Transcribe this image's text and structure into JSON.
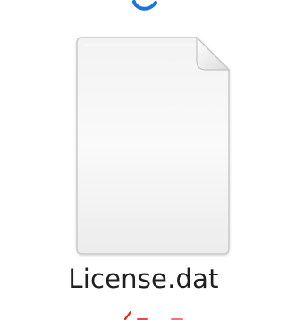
{
  "file": {
    "name": "License.dat",
    "icon": "blank-document-icon"
  },
  "colors": {
    "fragment_blue": "#1e73d9",
    "annotation_red": "#e0201a",
    "label_text": "#1f1f1f"
  }
}
